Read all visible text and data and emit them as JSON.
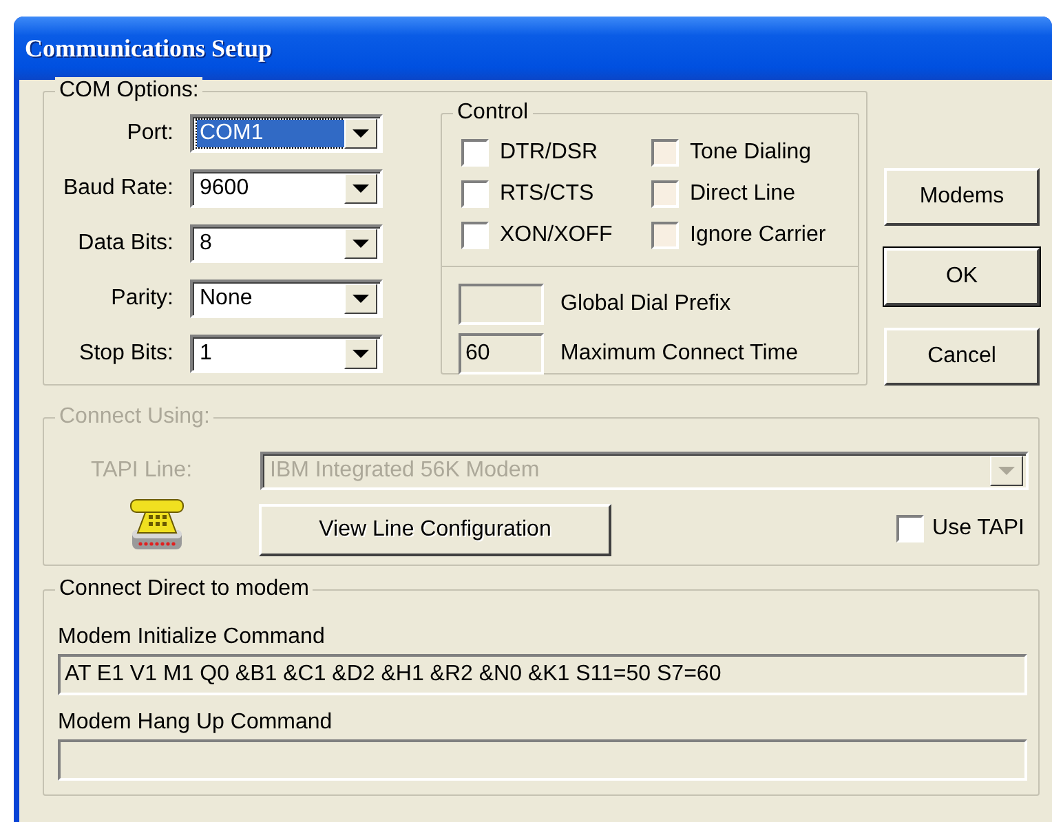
{
  "window": {
    "title": "Communications Setup"
  },
  "com_options": {
    "title": "COM Options:",
    "fields": [
      {
        "label": "Port:",
        "value": "COM1",
        "selected": true
      },
      {
        "label": "Baud Rate:",
        "value": "9600",
        "selected": false
      },
      {
        "label": "Data Bits:",
        "value": "8",
        "selected": false
      },
      {
        "label": "Parity:",
        "value": "None",
        "selected": false
      },
      {
        "label": "Stop Bits:",
        "value": "1",
        "selected": false
      }
    ]
  },
  "control": {
    "title": "Control",
    "checkboxes": [
      {
        "label": "DTR/DSR",
        "checked": false,
        "disabled": false
      },
      {
        "label": "Tone Dialing",
        "checked": false,
        "disabled": true
      },
      {
        "label": "RTS/CTS",
        "checked": false,
        "disabled": false
      },
      {
        "label": "Direct Line",
        "checked": false,
        "disabled": true
      },
      {
        "label": "XON/XOFF",
        "checked": false,
        "disabled": false
      },
      {
        "label": "Ignore Carrier",
        "checked": false,
        "disabled": true
      }
    ],
    "fields": [
      {
        "label": "Global Dial Prefix"
      },
      {
        "label": "Maximum Connect Time",
        "value": "60"
      }
    ]
  },
  "buttons": [
    {
      "label": "Modems",
      "default": false
    },
    {
      "label": "OK",
      "default": true
    },
    {
      "label": "Cancel",
      "default": false
    }
  ],
  "connect_using": {
    "title": "Connect Using:",
    "disabled": true,
    "tapi_line_label": "TAPI Line:",
    "tapi_line_value": "IBM Integrated 56K Modem",
    "view_button": "View Line Configuration",
    "use_tapi": {
      "label": "Use TAPI",
      "checked": false
    }
  },
  "connect_direct": {
    "title": "Connect Direct to modem",
    "fields": [
      {
        "label": "Modem Initialize Command",
        "value": "AT E1 V1 M1 Q0 &B1 &C1 &D2 &H1 &R2 &N0 &K1 S11=50 S7=60"
      },
      {
        "label": "Modem Hang Up Command"
      }
    ]
  }
}
